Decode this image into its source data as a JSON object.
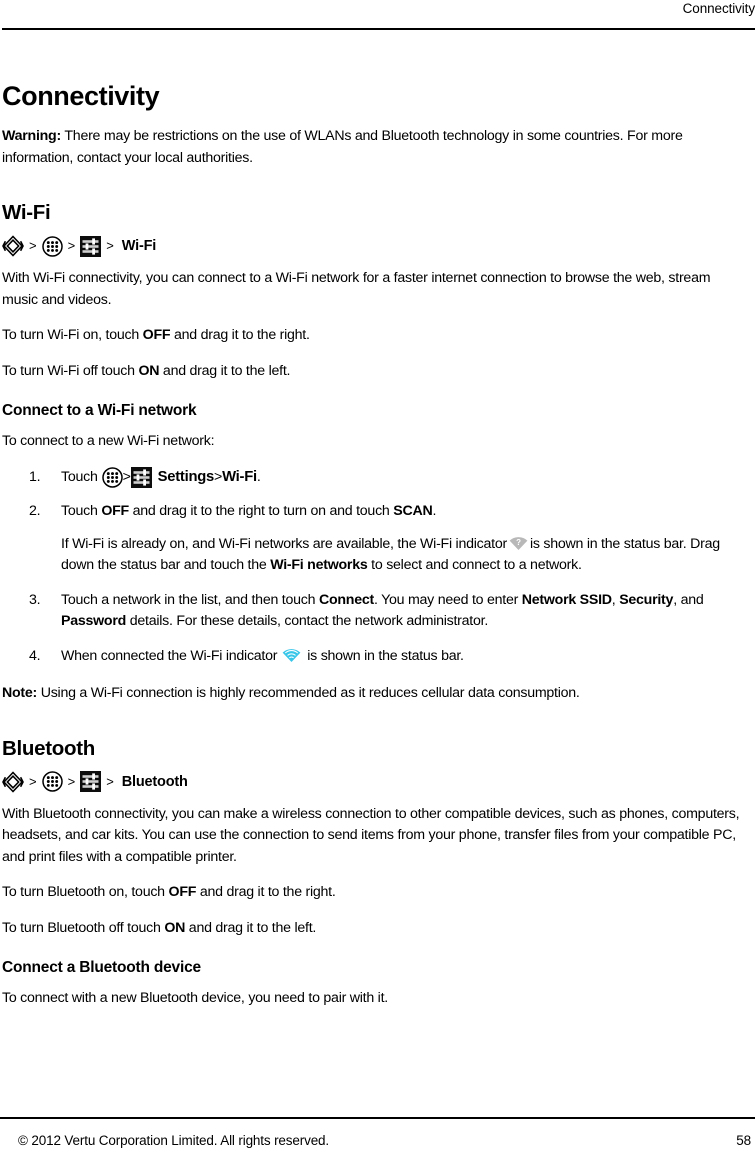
{
  "header": {
    "title": "Connectivity"
  },
  "page": {
    "title": "Connectivity",
    "warning_label": "Warning:",
    "warning_text": " There may be restrictions on the use of WLANs and Bluetooth technology in some countries. For more information, contact your local authorities."
  },
  "wifi": {
    "heading": "Wi-Fi",
    "breadcrumb": {
      "sep": ">",
      "icon1": "vertu-diamond-icon",
      "icon2": "app-drawer-icon",
      "icon3": "settings-icon",
      "label": "Wi-Fi"
    },
    "intro": "With Wi-Fi connectivity, you can connect to a Wi-Fi network for a faster internet connection to browse the web, stream music and videos.",
    "turn_on_pre": "To turn Wi-Fi on, touch ",
    "turn_on_bold": "OFF",
    "turn_on_post": " and drag it to the right.",
    "turn_off_pre": "To turn Wi-Fi off touch ",
    "turn_off_bold": "ON",
    "turn_off_post": " and drag it to the left.",
    "connect_heading": "Connect to a Wi-Fi network",
    "connect_intro": "To connect to a new Wi-Fi network:",
    "steps": {
      "s1_touch": "Touch",
      "s1_sep1": ">",
      "s1_settings": "Settings",
      "s1_sep2": ">",
      "s1_wifi": "Wi-Fi",
      "s1_period": ".",
      "s2_pre": "Touch ",
      "s2_b1": "OFF",
      "s2_mid": " and drag it to the right to turn on and touch ",
      "s2_b2": "SCAN",
      "s2_post": ".",
      "s2_sub_pre": "If Wi-Fi is already on, and Wi-Fi networks are available, the Wi-Fi indicator",
      "s2_sub_mid": "is shown in the status bar. Drag down the status bar and touch the ",
      "s2_sub_b": "Wi-Fi networks",
      "s2_sub_post": " to select and connect to a network.",
      "s3_pre": "Touch a network in the list, and then touch ",
      "s3_b1": "Connect",
      "s3_mid1": ". You may need to enter ",
      "s3_b2": "Network SSID",
      "s3_mid2": ", ",
      "s3_b3": "Security",
      "s3_mid3": ", and ",
      "s3_b4": "Password",
      "s3_post": " details. For these details, contact the network administrator.",
      "s4_pre": "When connected the Wi-Fi indicator",
      "s4_post": "is shown in the status bar."
    },
    "note_label": "Note:",
    "note_text": " Using a Wi-Fi connection is highly recommended as it reduces cellular data consumption."
  },
  "bluetooth": {
    "heading": "Bluetooth",
    "breadcrumb": {
      "sep": ">",
      "icon1": "vertu-diamond-icon",
      "icon2": "app-drawer-icon",
      "icon3": "settings-icon",
      "label": "Bluetooth"
    },
    "intro": "With Bluetooth connectivity, you can make a wireless connection to other compatible devices, such as phones, computers, headsets, and car kits. You can use the connection to send items from your phone, transfer files from your compatible PC, and print files with a compatible printer.",
    "turn_on_pre": "To turn Bluetooth on, touch ",
    "turn_on_bold": "OFF",
    "turn_on_post": " and drag it to the right.",
    "turn_off_pre": "To turn Bluetooth off touch ",
    "turn_off_bold": "ON",
    "turn_off_post": " and drag it to the left.",
    "connect_heading": "Connect a Bluetooth device",
    "connect_intro": "To connect with a new Bluetooth device, you need to pair with it."
  },
  "footer": {
    "copyright": "© 2012 Vertu Corporation Limited. All rights reserved.",
    "page_number": "58"
  },
  "colors": {
    "wifi_indicator_connected": "#38C6E9",
    "wifi_indicator_unknown": "#B5B5B5",
    "settings_tile": "#0D0D0D",
    "rule": "#000000"
  }
}
